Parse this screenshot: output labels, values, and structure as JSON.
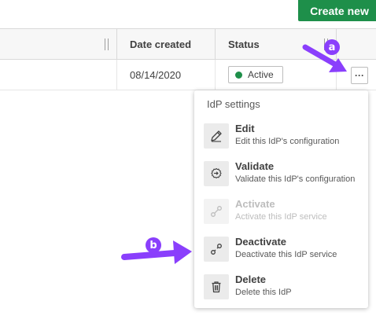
{
  "toolbar": {
    "create_new_label": "Create new"
  },
  "table": {
    "columns": [
      "",
      "Date created",
      "Status"
    ],
    "row": {
      "date_created": "08/14/2020",
      "status": "Active",
      "more_label": "···"
    }
  },
  "menu": {
    "title": "IdP settings",
    "items": [
      {
        "label": "Edit",
        "description": "Edit this IdP's configuration",
        "icon": "pencil-icon",
        "enabled": true
      },
      {
        "label": "Validate",
        "description": "Validate this IdP's configuration",
        "icon": "validate-icon",
        "enabled": true
      },
      {
        "label": "Activate",
        "description": "Activate this IdP service",
        "icon": "link-icon",
        "enabled": false
      },
      {
        "label": "Deactivate",
        "description": "Deactivate this IdP service",
        "icon": "unlink-icon",
        "enabled": true
      },
      {
        "label": "Delete",
        "description": "Delete this IdP",
        "icon": "trash-icon",
        "enabled": true
      }
    ]
  },
  "annotations": {
    "a": "a",
    "b": "b",
    "color": "#8a3ffc"
  },
  "colors": {
    "accent": "#1e8f4a",
    "status_active": "#1e8f4a"
  }
}
